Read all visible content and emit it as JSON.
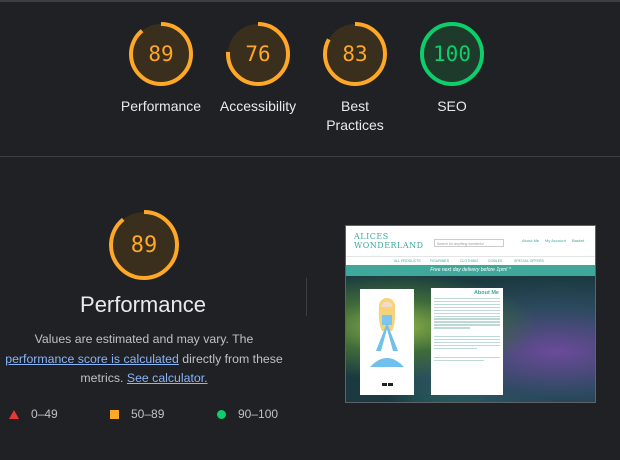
{
  "scores": [
    {
      "value": "89",
      "label": "Performance",
      "color": "#ffa726",
      "fraction": 0.89
    },
    {
      "value": "76",
      "label": "Accessibility",
      "color": "#ffa726",
      "fraction": 0.76
    },
    {
      "value": "83",
      "label": "Best Practices",
      "color": "#ffa726",
      "fraction": 0.83
    },
    {
      "value": "100",
      "label": "SEO",
      "color": "#0cce6b",
      "fraction": 1.0
    }
  ],
  "performance": {
    "value": "89",
    "fraction": 0.89,
    "title": "Performance",
    "desc_before": "Values are estimated and may vary. The ",
    "link_score": "performance score is calculated",
    "desc_middle": " directly from these metrics. ",
    "link_calc": "See calculator."
  },
  "legend": [
    {
      "icon": "triangle",
      "label": "0–49",
      "color": "#e53935"
    },
    {
      "icon": "square",
      "label": "50–89",
      "color": "#ffa726"
    },
    {
      "icon": "circle",
      "label": "90–100",
      "color": "#0cce6b"
    }
  ],
  "thumbnail": {
    "logo_line1": "ALICES",
    "logo_line2": "WONDERLAND",
    "search_placeholder": "Search for anything wonderful",
    "banner": "Free next day delivery before 1pm! *",
    "about_title": "About Me",
    "nav": [
      "ALL PRODUCTS",
      "FIGURINES",
      "CLOTHING",
      "GOBLES",
      "SPECIAL OFFERS"
    ],
    "header_icons": [
      "About Me",
      "My Account",
      "Basket"
    ]
  }
}
